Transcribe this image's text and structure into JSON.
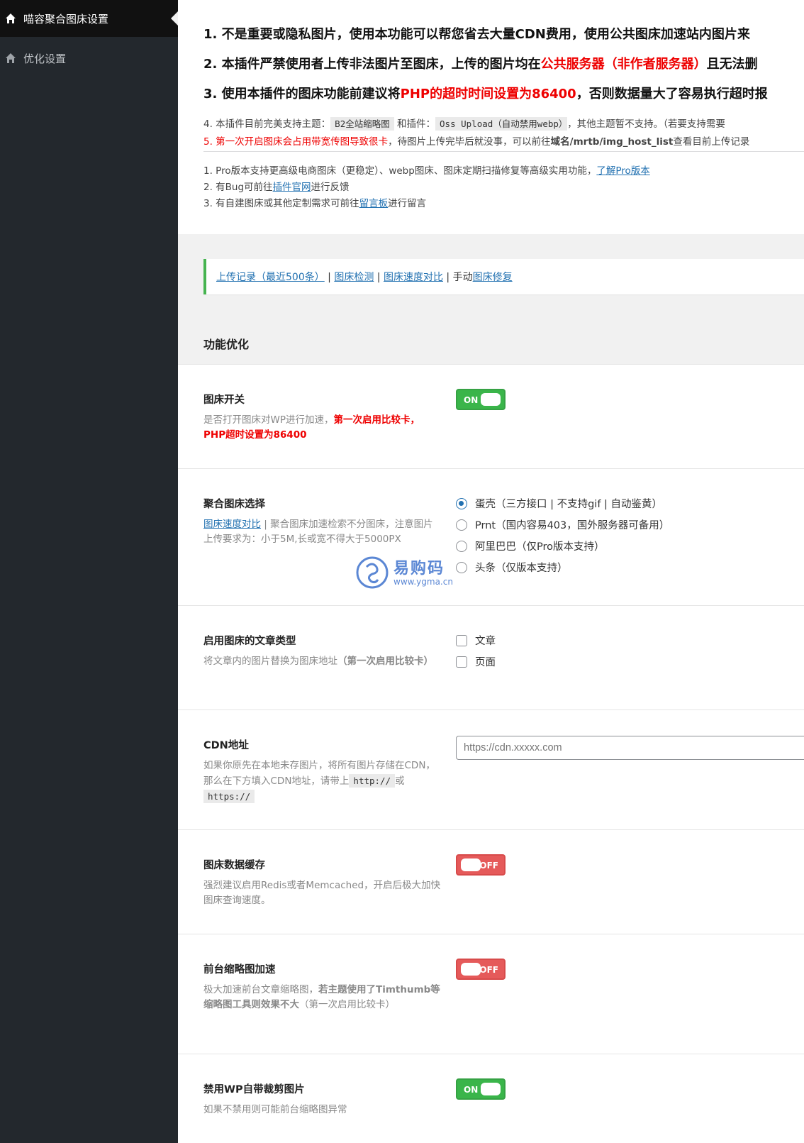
{
  "sidebar": {
    "items": [
      {
        "label": "喵容聚合图床设置"
      },
      {
        "label": "优化设置"
      }
    ]
  },
  "notices": {
    "line1": "1. 不是重要或隐私图片，使用本功能可以帮您省去大量CDN费用，使用公共图床加速站内图片来",
    "line2_a": "2. 本插件严禁使用者上传非法图片至图床，上传的图片均在",
    "line2_red": "公共服务器（非作者服务器）",
    "line2_b": "且无法删",
    "line3_a": "3. 使用本插件的图床功能前建议将",
    "line3_red": "PHP的超时时间设置为86400",
    "line3_b": "，否则数据量大了容易执行超时报",
    "line4_a": "4. 本插件目前完美支持主题：",
    "line4_code1": "B2全站缩略图",
    "line4_b": " 和插件：",
    "line4_code2": "Oss Upload（自动禁用webp）",
    "line4_c": "，其他主题暂不支持。（若要支持需要",
    "line5_red": "5. 第一次开启图床会占用带宽传图导致很卡",
    "line5_a": "，待图片上传完毕后就没事，可以前往",
    "line5_bold": "域名/mrtb/img_host_list",
    "line5_b": "查看目前上传记录"
  },
  "info": {
    "i1_text": "1. Pro版本支持更高级电商图床（更稳定）、webp图床、图床定期扫描修复等高级实用功能，",
    "i1_link": "了解Pro版本",
    "i2_text": "2. 有Bug可前往",
    "i2_link": "插件官网",
    "i2_tail": "进行反馈",
    "i3_text": "3. 有自建图床或其他定制需求可前往",
    "i3_link": "留言板",
    "i3_tail": "进行留言"
  },
  "links_bar": {
    "link1": "上传记录（最近500条）",
    "sep": " | ",
    "link2": "图床检测",
    "link3": "图床速度对比",
    "manual": "手动",
    "link4": "图床修复"
  },
  "section": {
    "title": "功能优化"
  },
  "rows": {
    "switch": {
      "title": "图床开关",
      "desc_a": "是否打开图床对WP进行加速，",
      "desc_red": "第一次启用比较卡，PHP超时设置为86400",
      "toggle": "ON"
    },
    "host_select": {
      "title": "聚合图床选择",
      "desc_link": "图床速度对比",
      "desc_a": " | 聚合图床加速检索不分图床，注意图片上传要求为：小于5M,长或宽不得大于5000PX",
      "options": [
        "蛋壳（三方接口 | 不支持gif | 自动鉴黄）",
        "Prnt（国内容易403，国外服务器可备用）",
        "阿里巴巴（仅Pro版本支持）",
        "头条（仅版本支持）"
      ],
      "selected": "蛋壳（三方接口 | 不支持gif | 自动鉴黄）"
    },
    "post_types": {
      "title": "启用图床的文章类型",
      "desc_a": "将文章内的图片替换为图床地址",
      "desc_bold": "（第一次启用比较卡）",
      "options": [
        "文章",
        "页面"
      ]
    },
    "cdn": {
      "title": "CDN地址",
      "desc_a": "如果你原先在本地未存图片，将所有图片存储在CDN，那么在下方填入CDN地址，请带上",
      "code1": "http://",
      "or": "或",
      "code2": "https://",
      "placeholder": "https://cdn.xxxxx.com"
    },
    "cache": {
      "title": "图床数据缓存",
      "desc_a": "强烈建议启用Redis或者Memcached，开启后极大加快图床查询速度。",
      "toggle": "OFF"
    },
    "thumb": {
      "title": "前台缩略图加速",
      "desc_a": "极大加速前台文章缩略图，",
      "desc_bold": "若主题使用了Timthumb等缩略图工具则效果不大",
      "desc_b": "（第一次启用比较卡）",
      "toggle": "OFF"
    },
    "crop": {
      "title": "禁用WP自带裁剪图片",
      "desc_a": "如果不禁用则可能前台缩略图异常",
      "toggle": "ON"
    }
  },
  "watermark": {
    "text": "易购码",
    "url": "www.ygma.cn"
  }
}
